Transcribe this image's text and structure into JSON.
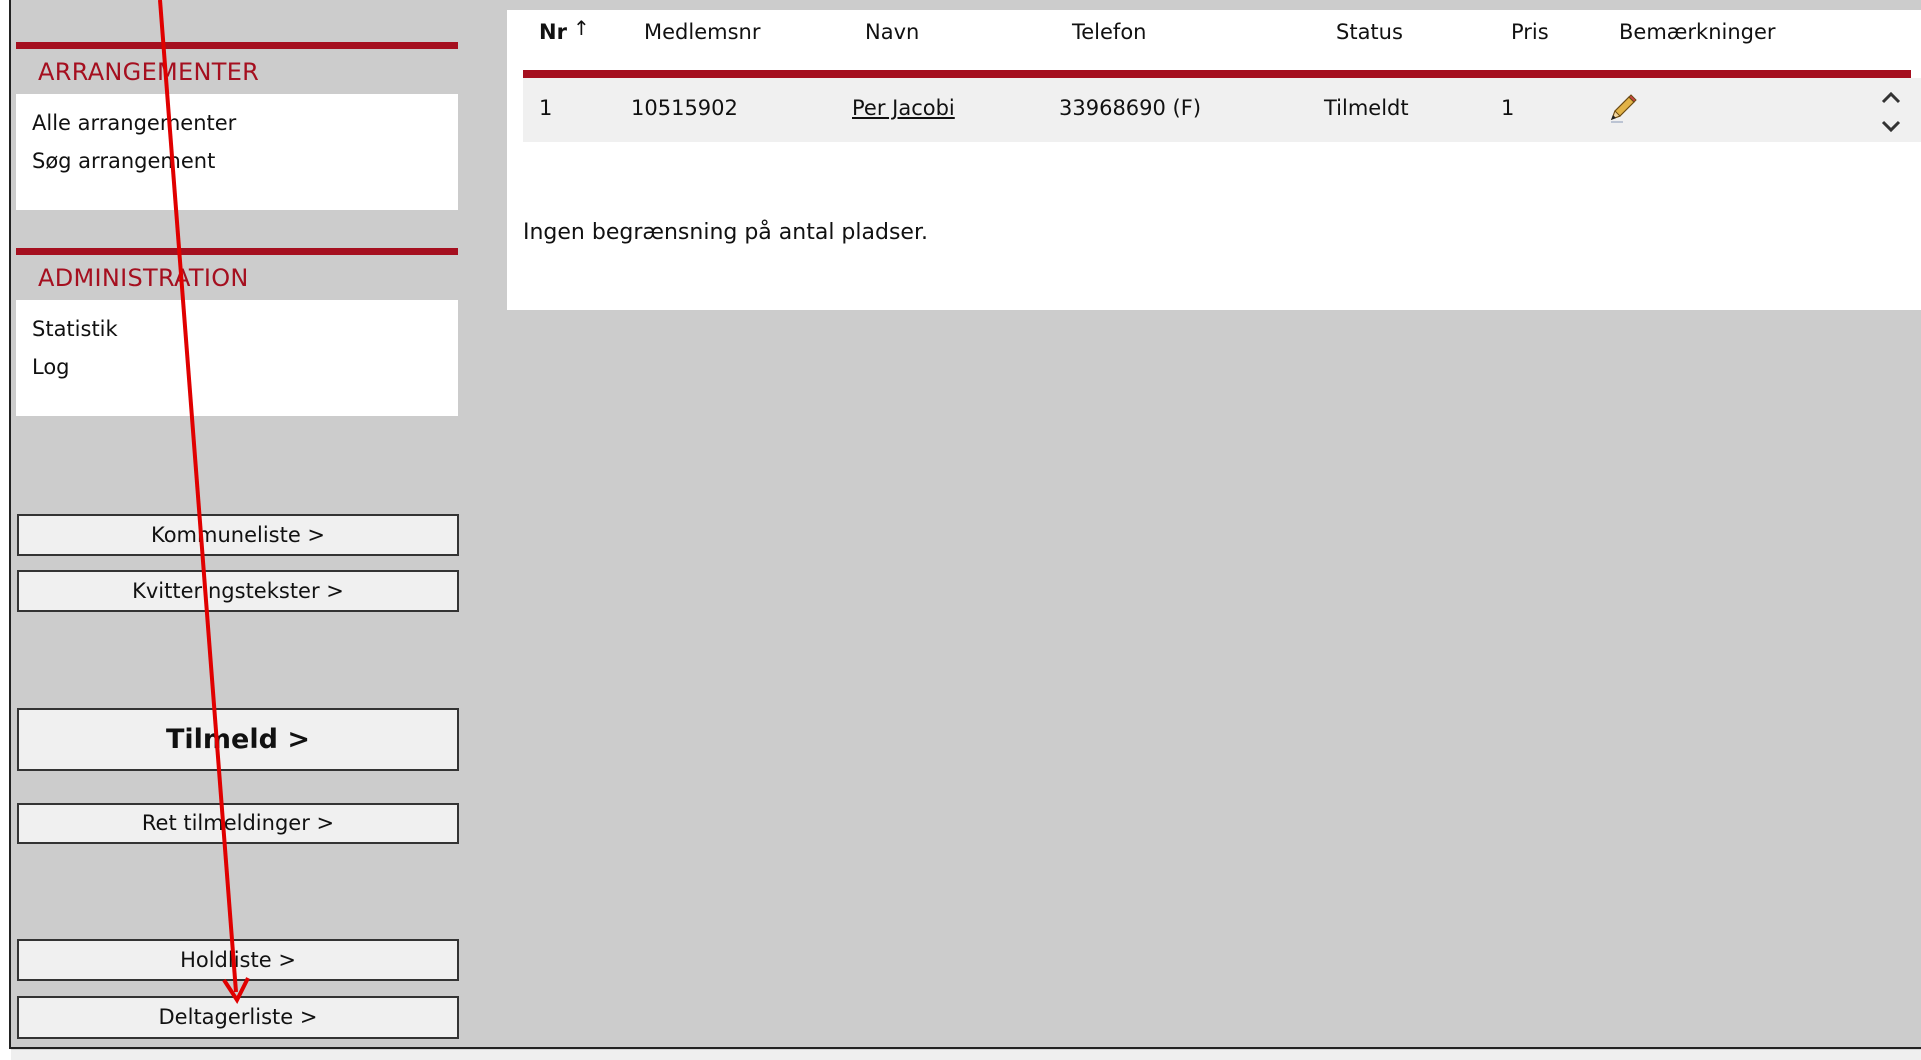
{
  "sidebar": {
    "arrangementer": {
      "title": "ARRANGEMENTER",
      "items": [
        "Alle arrangementer",
        "Søg arrangement"
      ]
    },
    "administration": {
      "title": "ADMINISTRATION",
      "items": [
        "Statistik",
        "Log"
      ]
    },
    "buttons": {
      "kommuneliste": "Kommuneliste >",
      "kvitteringstekster": "Kvitteringstekster >",
      "tilmeld": "Tilmeld >",
      "ret_tilmeldinger": "Ret tilmeldinger >",
      "holdliste": "Holdliste >",
      "deltagerliste": "Deltagerliste >"
    }
  },
  "table": {
    "headers": {
      "nr": "Nr",
      "sort_icon": "↑",
      "medlemsnr": "Medlemsnr",
      "navn": "Navn",
      "telefon": "Telefon",
      "status": "Status",
      "pris": "Pris",
      "bemaerkninger": "Bemærkninger"
    },
    "rows": [
      {
        "nr": "1",
        "medlemsnr": "10515902",
        "navn": "Per Jacobi",
        "telefon": "33968690 (F)",
        "status": "Tilmeldt",
        "pris": "1",
        "bemaerkninger_icon": "pencil-icon"
      }
    ]
  },
  "note": "Ingen begrænsning på antal pladser.",
  "colors": {
    "accent": "#a50f1f",
    "background": "#cccccc",
    "annotation": "#e00000"
  }
}
